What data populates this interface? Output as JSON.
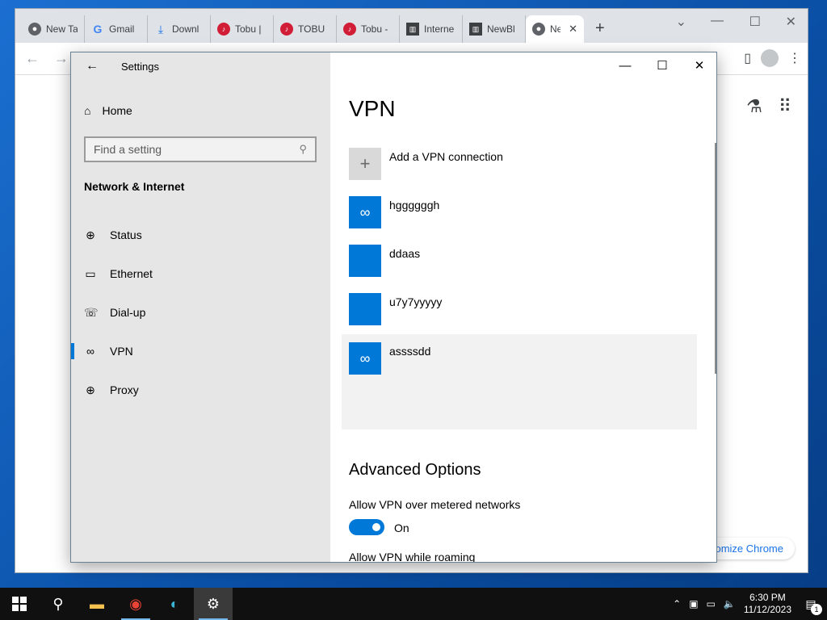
{
  "chrome": {
    "tabs": [
      {
        "icon": "chrome-icon",
        "title": "New Ta"
      },
      {
        "icon": "google-icon",
        "title": "Gmail"
      },
      {
        "icon": "download-icon",
        "title": "Downl"
      },
      {
        "icon": "music-icon",
        "title": "Tobu |"
      },
      {
        "icon": "music-icon",
        "title": "TOBU"
      },
      {
        "icon": "music-icon",
        "title": "Tobu -"
      },
      {
        "icon": "bank-icon",
        "title": "Interne"
      },
      {
        "icon": "bank-icon",
        "title": "NewBl"
      },
      {
        "icon": "chrome-icon",
        "title": "Ne"
      }
    ],
    "customize_label": "omize Chrome"
  },
  "settings": {
    "window_title": "Settings",
    "home_label": "Home",
    "search_placeholder": "Find a setting",
    "section_title": "Network & Internet",
    "nav": [
      {
        "label": "Status",
        "icon": "globe-status-icon"
      },
      {
        "label": "Ethernet",
        "icon": "ethernet-icon"
      },
      {
        "label": "Dial-up",
        "icon": "dialup-icon"
      },
      {
        "label": "VPN",
        "icon": "vpn-icon"
      },
      {
        "label": "Proxy",
        "icon": "globe-icon"
      }
    ],
    "selected_nav": "VPN",
    "page_title": "VPN",
    "add_vpn_label": "Add a VPN connection",
    "connections": [
      {
        "name": "hggggggh",
        "icon": "vpn-link-icon"
      },
      {
        "name": "ddaas",
        "icon": ""
      },
      {
        "name": "u7y7yyyyy",
        "icon": ""
      },
      {
        "name": "assssdd",
        "icon": "vpn-link-icon"
      }
    ],
    "advanced_title": "Advanced Options",
    "metered_label": "Allow VPN over metered networks",
    "metered_state": "On",
    "roaming_label": "Allow VPN while roaming"
  },
  "taskbar": {
    "time": "6:30 PM",
    "date": "11/12/2023",
    "notification_count": "1"
  },
  "colors": {
    "accent": "#0078d7",
    "sidebar_bg": "#e6e6e6",
    "taskbar_bg": "#101010"
  }
}
